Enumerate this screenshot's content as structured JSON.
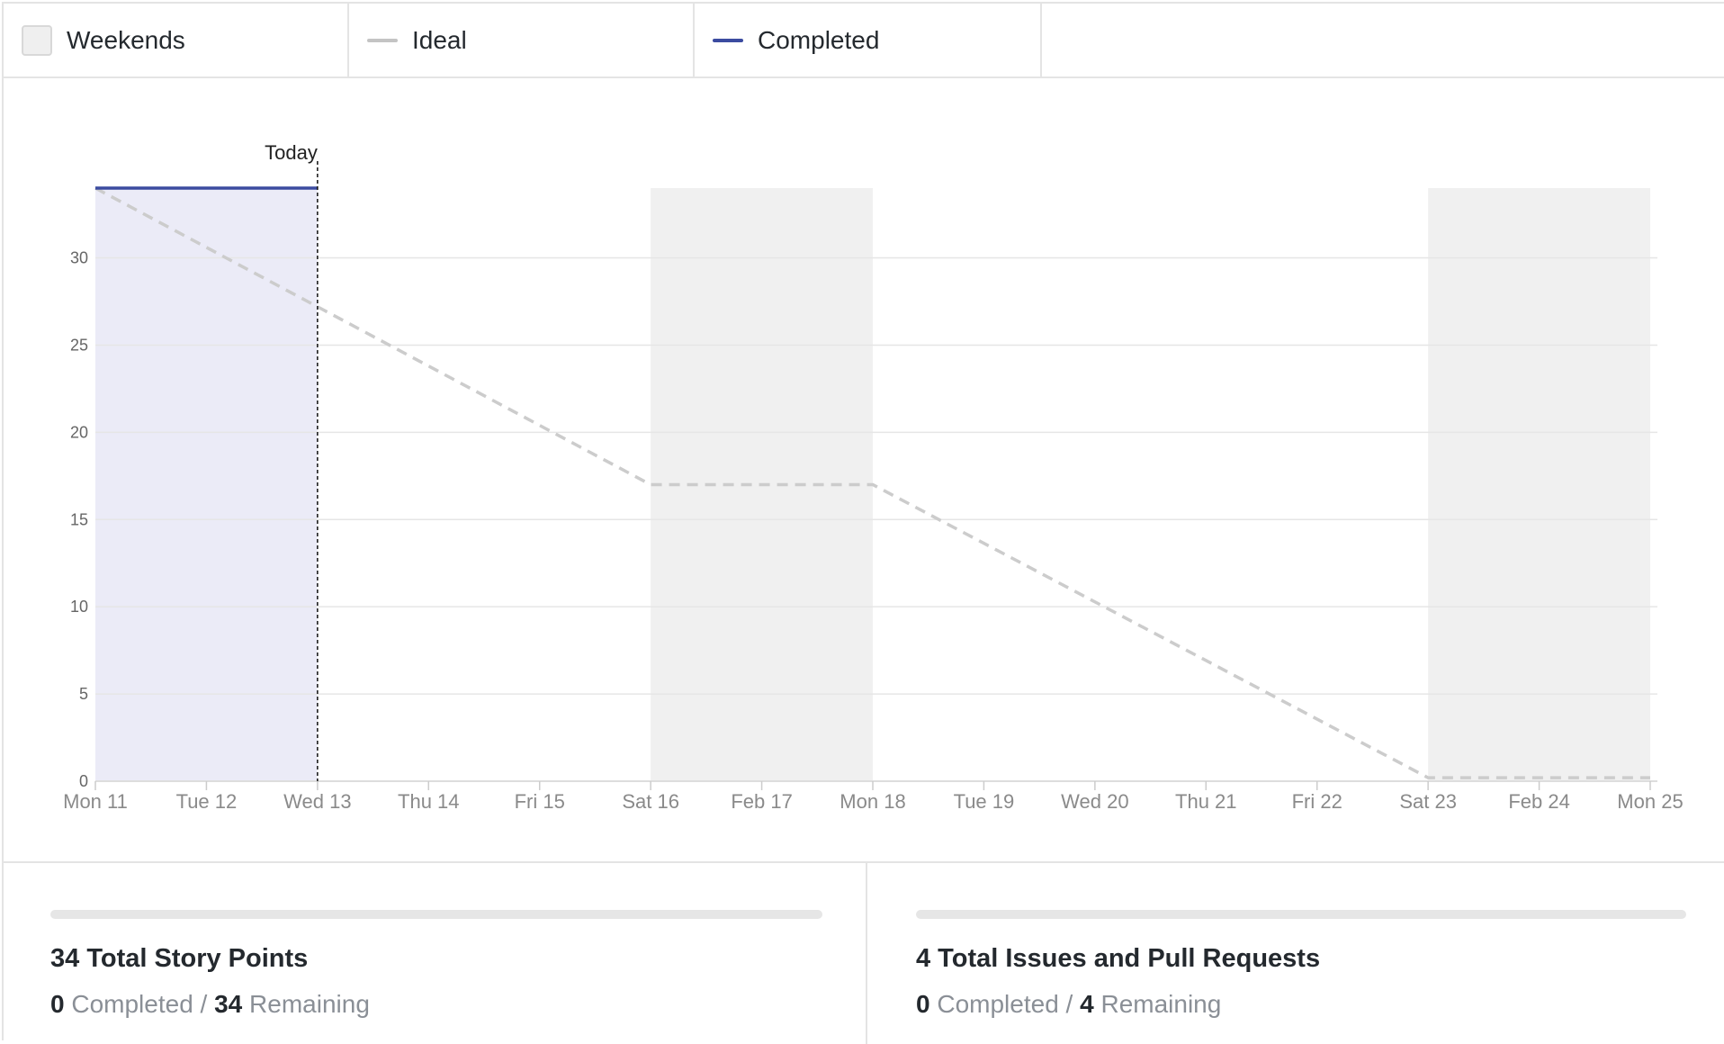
{
  "legend": {
    "weekends_label": "Weekends",
    "ideal_label": "Ideal",
    "completed_label": "Completed"
  },
  "colors": {
    "completed_line": "#3b4ba0",
    "completed_fill": "#ebebf7",
    "ideal_line": "#cccccc",
    "weekend_fill": "#f0f0f0",
    "grid": "#e6e6e6",
    "today_line": "#111111"
  },
  "chart_data": {
    "type": "line",
    "x": [
      "Mon 11",
      "Tue 12",
      "Wed 13",
      "Thu 14",
      "Fri 15",
      "Sat 16",
      "Feb 17",
      "Mon 18",
      "Tue 19",
      "Wed 20",
      "Thu 21",
      "Fri 22",
      "Sat 23",
      "Feb 24",
      "Mon 25"
    ],
    "ylim": [
      0,
      34
    ],
    "yticks": [
      0,
      5,
      10,
      15,
      20,
      25,
      30
    ],
    "grid": true,
    "weekends": [
      [
        "Sat 16",
        "Mon 18"
      ],
      [
        "Sat 23",
        "Mon 25"
      ]
    ],
    "today": {
      "label": "Today",
      "x": "Wed 13"
    },
    "series": [
      {
        "name": "Ideal",
        "style": "dashed",
        "points": [
          [
            "Mon 11",
            34
          ],
          [
            "Sat 16",
            17
          ],
          [
            "Mon 18",
            17
          ],
          [
            "Sat 23",
            0.2
          ],
          [
            "Mon 25",
            0.2
          ]
        ]
      },
      {
        "name": "Completed",
        "style": "solid",
        "points": [
          [
            "Mon 11",
            34
          ],
          [
            "Wed 13",
            34
          ]
        ]
      }
    ]
  },
  "story_points": {
    "title": "34 Total Story Points",
    "completed": "0",
    "completed_label": "Completed",
    "separator": "/",
    "remaining": "34",
    "remaining_label": "Remaining",
    "progress": 0
  },
  "issues": {
    "title": "4 Total Issues and Pull Requests",
    "completed": "0",
    "completed_label": "Completed",
    "separator": "/",
    "remaining": "4",
    "remaining_label": "Remaining",
    "progress": 0
  }
}
